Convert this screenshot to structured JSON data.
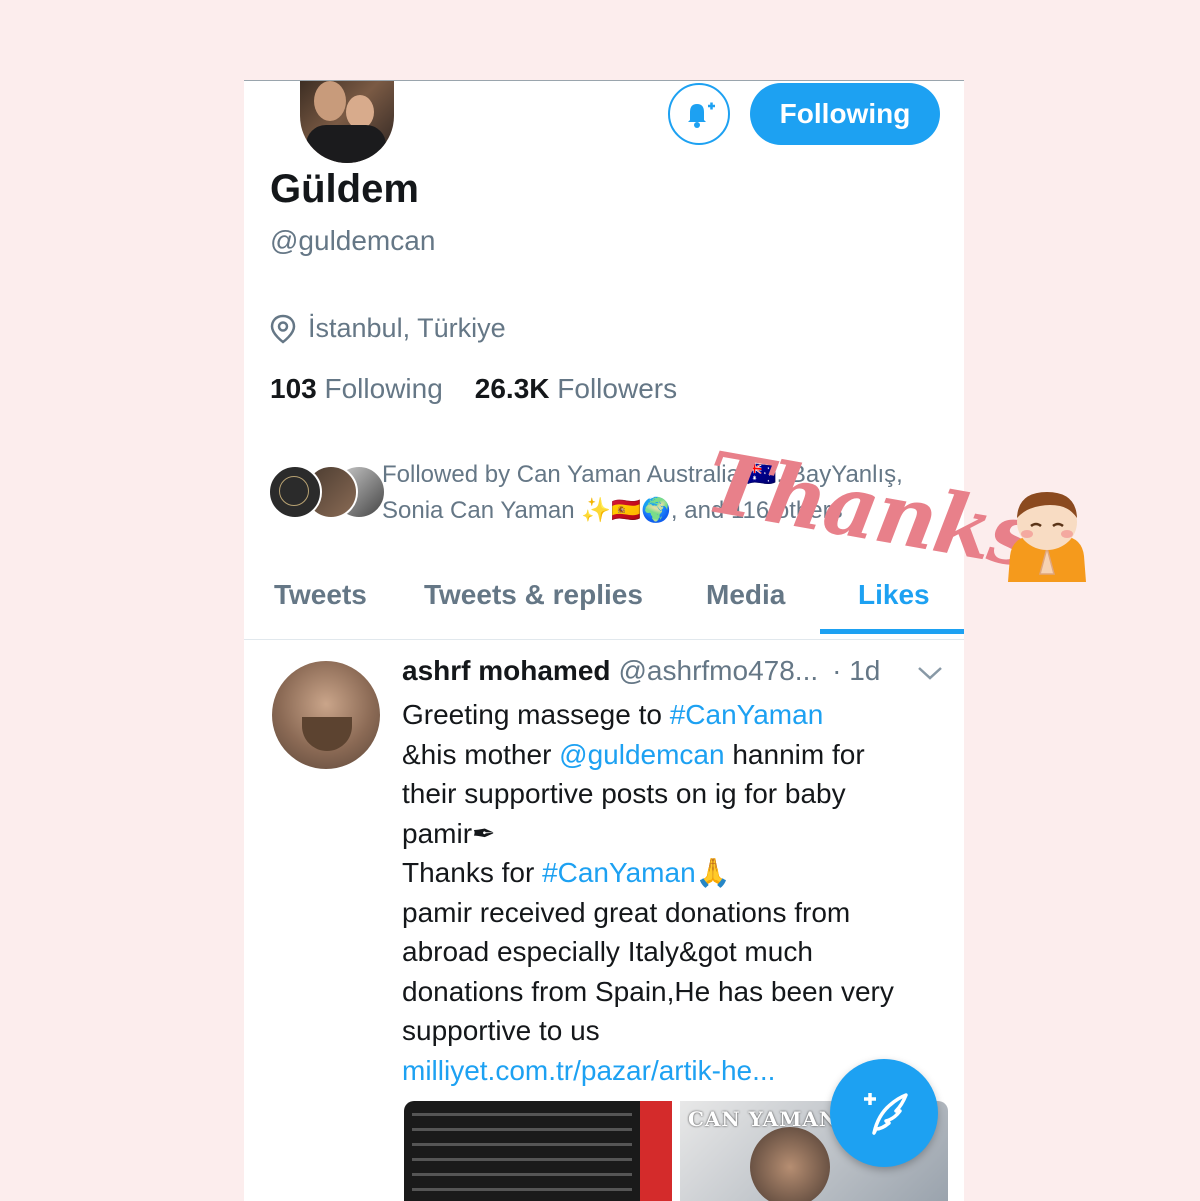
{
  "header": {
    "follow_button_label": "Following"
  },
  "profile": {
    "name": "Güldem",
    "handle": "@guldemcan",
    "location": "İstanbul, Türkiye",
    "following_count": "103",
    "following_label": "Following",
    "followers_count": "26.3K",
    "followers_label": "Followers",
    "followed_by_line1": "Followed by Can Yaman Australia 🇦🇺, BayYanlış,",
    "followed_by_line2": "Sonia Can Yaman ✨🇪🇸🌍, and 116 others"
  },
  "tabs": [
    {
      "label": "Tweets"
    },
    {
      "label": "Tweets & replies"
    },
    {
      "label": "Media"
    },
    {
      "label": "Likes",
      "active": true
    }
  ],
  "tweet": {
    "author_name": "ashrf mohamed",
    "author_handle": "@ashrfmo478...",
    "time": "· 1d",
    "line1_prefix": "Greeting massege to ",
    "line1_tag": "#CanYaman",
    "line2_prefix": "&his mother ",
    "line2_mention": "@guldemcan",
    "line2_suffix": " hannim for",
    "line3": "their supportive posts on ig for baby",
    "line4": "pamir✒",
    "line5_prefix": "Thanks for ",
    "line5_tag": "#CanYaman",
    "line5_suffix": "🙏",
    "line6": "pamir received great donations from",
    "line7": "abroad especially Italy&got much",
    "line8": "donations from Spain,He has been very",
    "line9": "supportive to us",
    "link": "milliyet.com.tr/pazar/artik-he...",
    "media_caption": "CAN YAMAN"
  },
  "overlay": {
    "thanks_text": "Thanks"
  },
  "colors": {
    "accent": "#1da1f2",
    "secondary_text": "#657786",
    "background": "#fceded",
    "thanks": "#e8808a"
  },
  "icons": [
    "bell-plus-icon",
    "location-pin-icon",
    "chevron-down-icon",
    "compose-feather-icon"
  ]
}
